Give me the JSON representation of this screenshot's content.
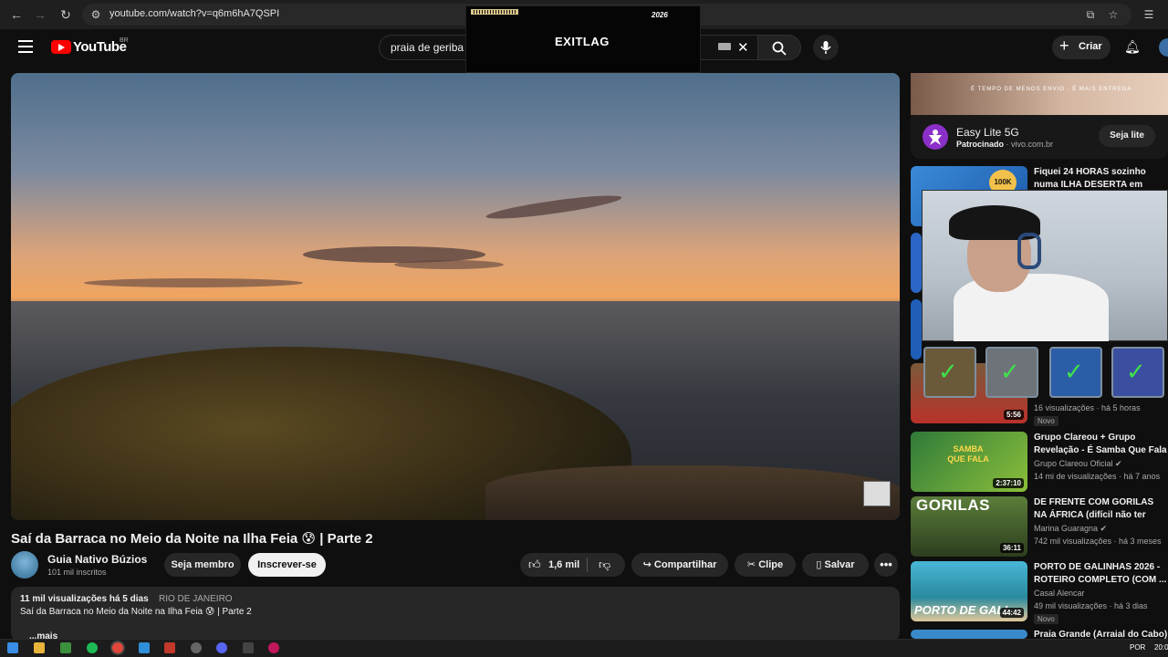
{
  "browser": {
    "url": "youtube.com/watch?v=q6m6hA7QSPI"
  },
  "header": {
    "logo_text": "YouTube",
    "region": "BR",
    "search_value": "praia de geriba",
    "create_label": "Criar"
  },
  "overlay": {
    "brand": "EXITLAG",
    "tag": "2026"
  },
  "video": {
    "title": "Saí da Barraca no Meio da Noite na Ilha Feia 😰 | Parte 2",
    "channel_name": "Guia Nativo Búzios",
    "channel_subs": "101 mil inscritos",
    "member_label": "Seja membro",
    "subscribe_label": "Inscrever-se",
    "likes": "1,6 mil",
    "share_label": "Compartilhar",
    "clip_label": "Clipe",
    "save_label": "Salvar",
    "more_label": "•••"
  },
  "description": {
    "views_time": "11 mil visualizações  há 5 dias",
    "location": "RIO DE JANEIRO",
    "text": "Saí da Barraca no Meio da Noite na Ilha Feia 😰 | Parte 2",
    "more": "...mais"
  },
  "ad": {
    "banner_text": "É TEMPO DE MENOS ENVIO · É MAIS ENTREGA",
    "title": "Easy Lite 5G",
    "sponsor": "Patrocinado",
    "domain": "vivo.com.br",
    "cta": "Seja lite"
  },
  "recommendations": [
    {
      "title": "Fiquei 24 HORAS sozinho numa ILHA DESERTA em Búzios - ...",
      "meta": "",
      "duration": "",
      "badge": ""
    },
    {
      "title": "",
      "meta": "16 visualizações · há 5 horas",
      "duration": "5:56",
      "badge": "Novo"
    },
    {
      "title": "Grupo Clareou + Grupo Revelação - É Samba Que Fala",
      "channel": "Grupo Clareou Oficial ✔",
      "meta": "14 mi de visualizações · há 7 anos",
      "duration": "2:37:10",
      "badge": ""
    },
    {
      "title": "DE FRENTE COM GORILAS NA ÁFRICA (difícil não ter medo)",
      "channel": "Marina Guaragna ✔",
      "meta": "742 mil visualizações · há 3 meses",
      "duration": "36:11",
      "badge": ""
    },
    {
      "title": "PORTO DE GALINHAS 2026 - ROTEIRO COMPLETO (COM ...",
      "channel": "Casal Alencar",
      "meta": "49 mil visualizações · há 3 dias",
      "duration": "44:42",
      "badge": "Novo"
    },
    {
      "title": "Praia Grande (Arraial do Cabo)",
      "meta": "",
      "duration": "",
      "badge": ""
    }
  ],
  "thumb_texts": {
    "t1_badge": "100K",
    "t3_text": "SAMBA QUE FALA",
    "t4_text": "GORILAS",
    "t5_text": "PORTO DE GALI"
  },
  "taskbar": {
    "lang": "POR",
    "time": "20:0"
  },
  "colors": {
    "background": "#0f0f0f",
    "accent_red": "#ff0000",
    "pill": "#272727"
  }
}
